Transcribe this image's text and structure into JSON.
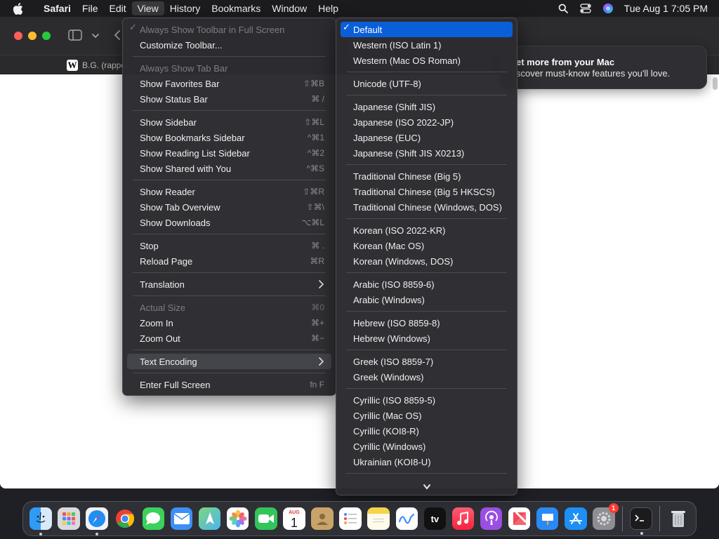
{
  "menubar": {
    "app": "Safari",
    "items": [
      "File",
      "Edit",
      "View",
      "History",
      "Bookmarks",
      "Window",
      "Help"
    ],
    "clock": "Tue Aug 1  7:05 PM",
    "active_item": "View"
  },
  "window": {
    "tab_title": "B.G. (rappe"
  },
  "notification": {
    "title": "et more from your Mac",
    "body": "scover must-know features you'll love."
  },
  "view_menu": {
    "items": [
      {
        "label": "Always Show Toolbar in Full Screen",
        "shortcut": "",
        "disabled": true,
        "checked": true
      },
      {
        "label": "Customize Toolbar...",
        "shortcut": ""
      },
      {
        "label": "Always Show Tab Bar",
        "shortcut": "",
        "disabled": true
      },
      {
        "label": "Show Favorites Bar",
        "shortcut": "⇧⌘B"
      },
      {
        "label": "Show Status Bar",
        "shortcut": "⌘ /"
      },
      {
        "label": "Show Sidebar",
        "shortcut": "⇧⌘L"
      },
      {
        "label": "Show Bookmarks Sidebar",
        "shortcut": "^⌘1"
      },
      {
        "label": "Show Reading List Sidebar",
        "shortcut": "^⌘2"
      },
      {
        "label": "Show Shared with You",
        "shortcut": "^⌘S"
      },
      {
        "label": "Show Reader",
        "shortcut": "⇧⌘R"
      },
      {
        "label": "Show Tab Overview",
        "shortcut": "⇧⌘\\"
      },
      {
        "label": "Show Downloads",
        "shortcut": "⌥⌘L"
      },
      {
        "label": "Stop",
        "shortcut": "⌘ ."
      },
      {
        "label": "Reload Page",
        "shortcut": "⌘R"
      },
      {
        "label": "Translation",
        "submenu": true
      },
      {
        "label": "Actual Size",
        "shortcut": "⌘0",
        "disabled": true
      },
      {
        "label": "Zoom In",
        "shortcut": "⌘+"
      },
      {
        "label": "Zoom Out",
        "shortcut": "⌘−"
      },
      {
        "label": "Text Encoding",
        "submenu": true,
        "highlighted": true
      },
      {
        "label": "Enter Full Screen",
        "shortcut": "fn F"
      }
    ]
  },
  "encoding_menu": {
    "selected": "Default",
    "items": [
      "Default",
      "Western (ISO Latin 1)",
      "Western (Mac OS Roman)",
      "Unicode (UTF-8)",
      "Japanese (Shift JIS)",
      "Japanese (ISO 2022-JP)",
      "Japanese (EUC)",
      "Japanese (Shift JIS X0213)",
      "Traditional Chinese (Big 5)",
      "Traditional Chinese (Big 5 HKSCS)",
      "Traditional Chinese (Windows, DOS)",
      "Korean (ISO 2022-KR)",
      "Korean (Mac OS)",
      "Korean (Windows, DOS)",
      "Arabic (ISO 8859-6)",
      "Arabic (Windows)",
      "Hebrew (ISO 8859-8)",
      "Hebrew (Windows)",
      "Greek (ISO 8859-7)",
      "Greek (Windows)",
      "Cyrillic (ISO 8859-5)",
      "Cyrillic (Mac OS)",
      "Cyrillic (KOI8-R)",
      "Cyrillic (Windows)",
      "Ukrainian (KOI8-U)"
    ]
  },
  "dock": {
    "calendar_month": "AUG",
    "calendar_day": "1",
    "tv_label": "tv",
    "settings_badge": "1",
    "apps": [
      "finder-icon",
      "launchpad-icon",
      "safari-icon",
      "chrome-icon",
      "messages-icon",
      "mail-icon",
      "maps-icon",
      "photos-icon",
      "facetime-icon",
      "calendar-icon",
      "contacts-icon",
      "reminders-icon",
      "notes-icon",
      "freeform-icon",
      "appletv-icon",
      "music-icon",
      "podcasts-icon",
      "news-icon",
      "keynote-icon",
      "appstore-icon",
      "settings-icon",
      "terminal-icon",
      "trash-icon"
    ]
  },
  "colors": {
    "selection": "#0a5fd8",
    "menu_bg": "#2c2c30",
    "highlight": "#44454b"
  }
}
